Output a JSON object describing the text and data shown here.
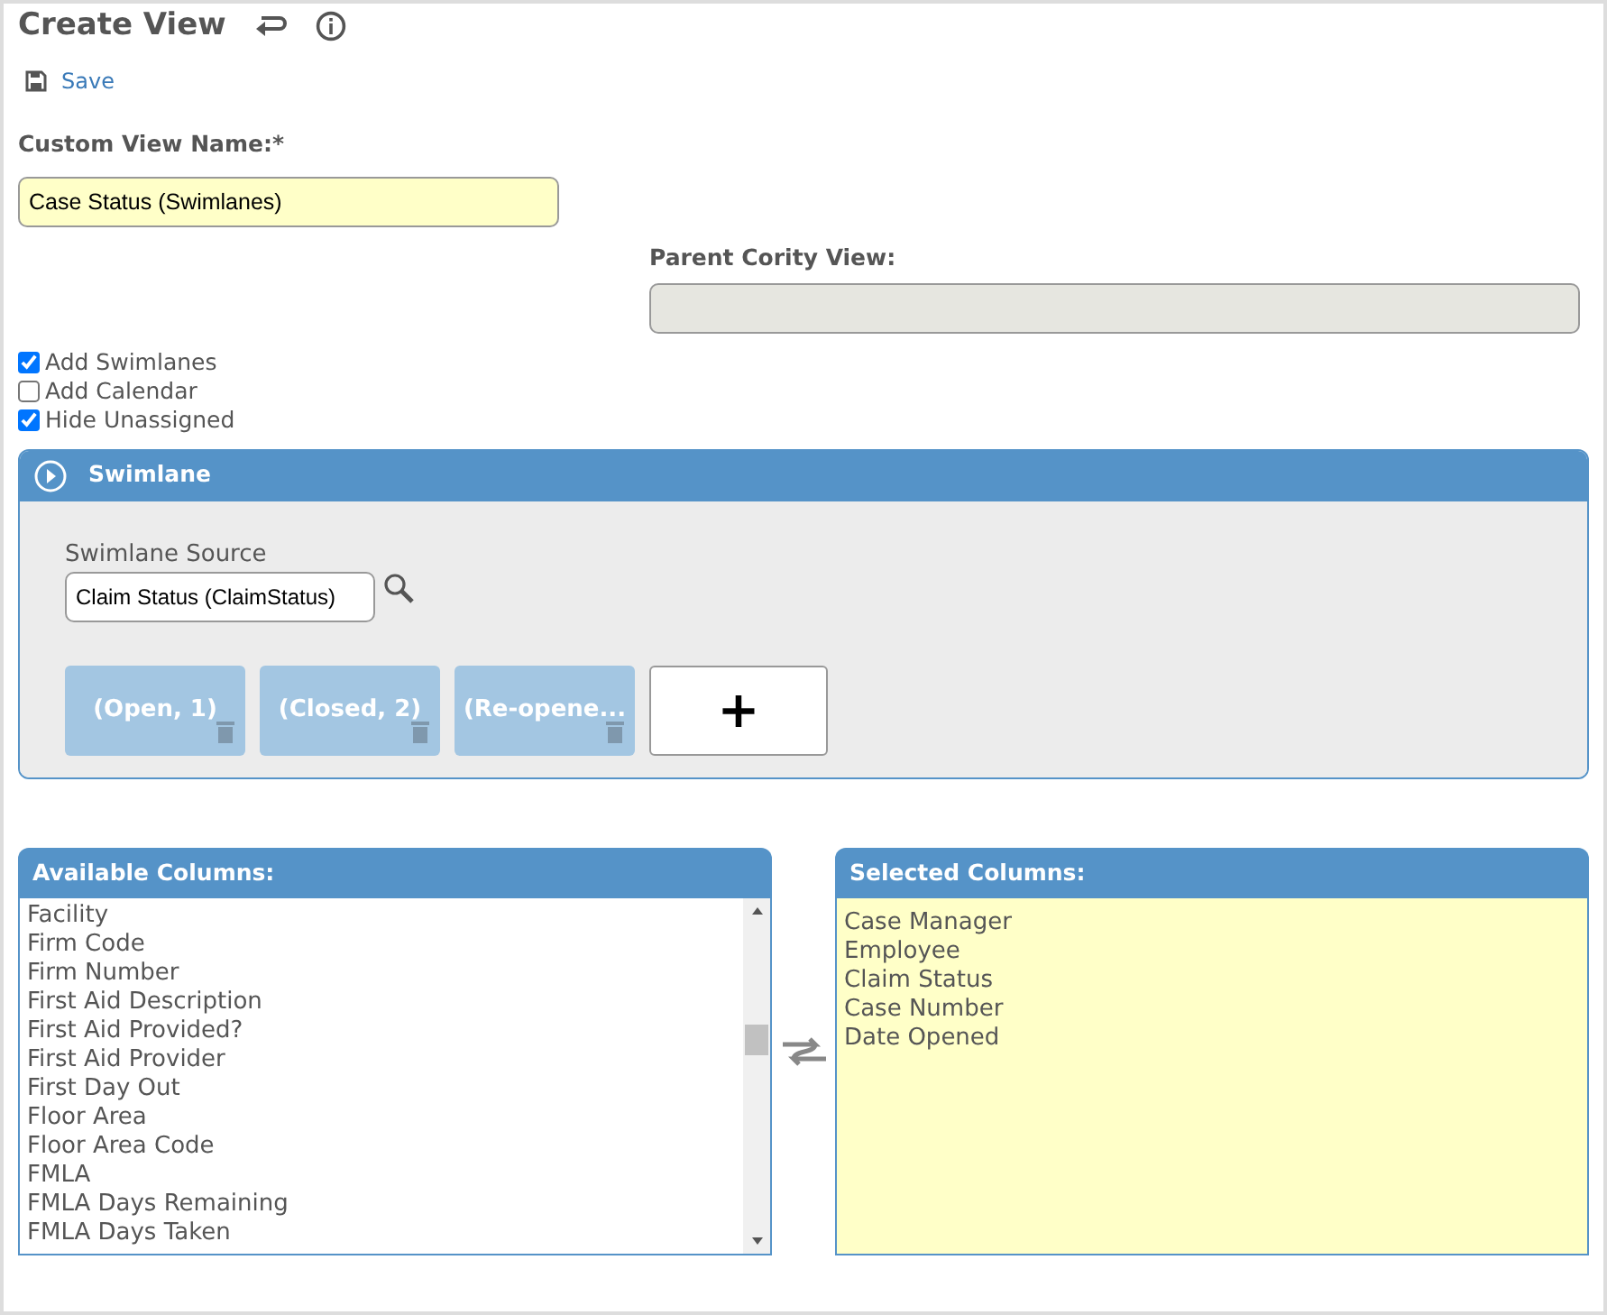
{
  "title": "Create View",
  "toolbar": {
    "save": "Save"
  },
  "custom_view_name": {
    "label": "Custom View Name:*",
    "value": "Case Status (Swimlanes)"
  },
  "parent_view": {
    "label": "Parent Cority View:"
  },
  "options": [
    {
      "label": "Add Swimlanes",
      "checked": true
    },
    {
      "label": "Add Calendar",
      "checked": false
    },
    {
      "label": "Hide Unassigned",
      "checked": true
    }
  ],
  "swimlane_panel": {
    "title": "Swimlane",
    "source_label": "Swimlane Source",
    "source_value": "Claim Status (ClaimStatus)",
    "lanes": [
      {
        "label": "(Open, 1)"
      },
      {
        "label": "(Closed, 2)"
      },
      {
        "label": "(Re-opene..."
      }
    ],
    "add_button": "+"
  },
  "available_columns": {
    "title": "Available Columns:",
    "items": [
      "Facility",
      "Firm Code",
      "Firm Number",
      "First Aid Description",
      "First Aid Provided?",
      "First Aid Provider",
      "First Day Out",
      "Floor Area",
      "Floor Area Code",
      "FMLA",
      "FMLA Days Remaining",
      "FMLA Days Taken"
    ]
  },
  "selected_columns": {
    "title": "Selected Columns:",
    "items": [
      "Case Manager",
      "Employee",
      "Claim Status",
      "Case Number",
      "Date Opened"
    ]
  }
}
